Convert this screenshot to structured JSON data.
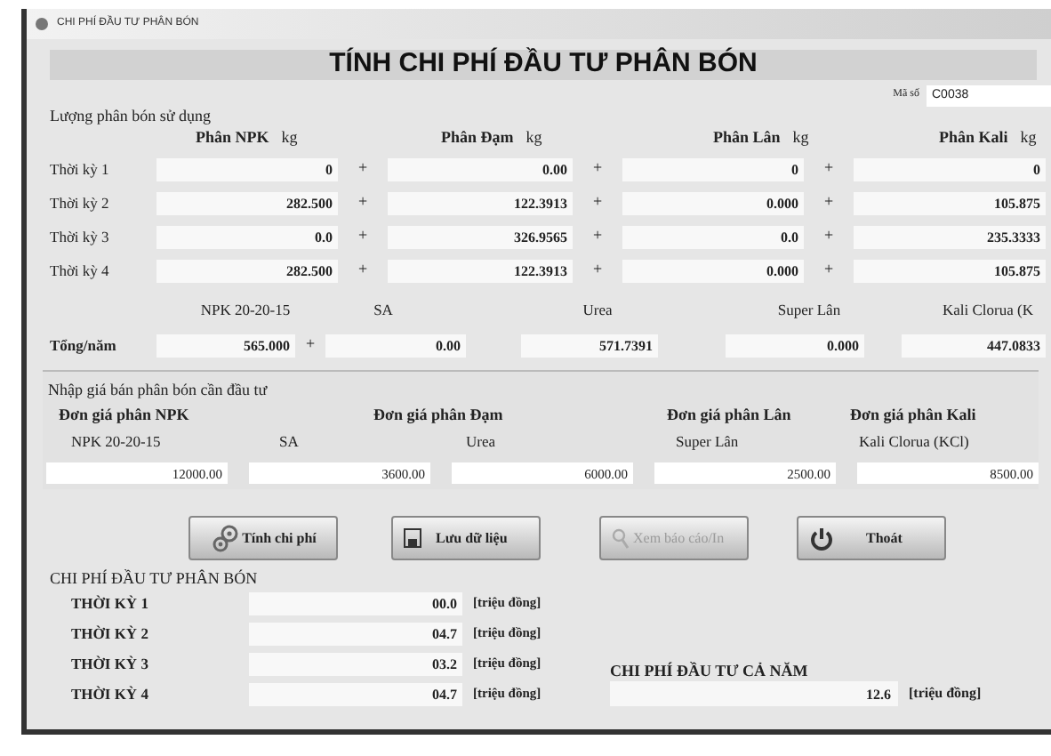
{
  "window": {
    "title": "CHI PHÍ ĐẦU TƯ PHÂN BÓN"
  },
  "header": "TÍNH CHI PHÍ ĐẦU TƯ PHÂN BÓN",
  "code": {
    "label": "Mã số",
    "value": "C0038"
  },
  "usage": {
    "title": "Lượng phân bón sử dụng",
    "columns": [
      {
        "name": "Phân NPK",
        "unit": "kg"
      },
      {
        "name": "Phân Đạm",
        "unit": "kg"
      },
      {
        "name": "Phân Lân",
        "unit": "kg"
      },
      {
        "name": "Phân Kali",
        "unit": "kg"
      }
    ],
    "rows": [
      {
        "label": "Thời kỳ 1",
        "cells": [
          {
            "value": "0",
            "plus": "+"
          },
          {
            "value": "0.00",
            "plus": "+"
          },
          {
            "value": "0",
            "plus": "+"
          },
          {
            "value": "0"
          }
        ]
      },
      {
        "label": "Thời kỳ 2",
        "cells": [
          {
            "value": "282.500",
            "plus": "+"
          },
          {
            "value": "122.3913",
            "plus": "+"
          },
          {
            "value": "0.000",
            "plus": "+"
          },
          {
            "value": "105.875"
          }
        ]
      },
      {
        "label": "Thời kỳ 3",
        "cells": [
          {
            "value": "0.0",
            "plus": "+"
          },
          {
            "value": "326.9565",
            "plus": "+"
          },
          {
            "value": "0.0",
            "plus": "+"
          },
          {
            "value": "235.3333"
          }
        ]
      },
      {
        "label": "Thời kỳ 4",
        "cells": [
          {
            "value": "282.500",
            "plus": "+"
          },
          {
            "value": "122.3913",
            "plus": "+"
          },
          {
            "value": "0.000",
            "plus": "+"
          },
          {
            "value": "105.875"
          }
        ]
      }
    ],
    "products": [
      "NPK 20-20-15",
      "SA",
      "Urea",
      "Super Lân",
      "Kali Clorua (K"
    ],
    "total": {
      "label": "Tổng/năm",
      "cells": [
        {
          "value": "565.000",
          "plus": "+"
        },
        {
          "value": "0.00"
        },
        {
          "value": "571.7391"
        },
        {
          "value": "0.000"
        },
        {
          "value": "447.0833"
        }
      ]
    }
  },
  "prices": {
    "title": "Nhập giá bán phân bón cần đầu tư",
    "headers": [
      "Đơn giá phân NPK",
      "Đơn giá phân Đạm",
      "Đơn giá phân Lân",
      "Đơn giá phân Kali"
    ],
    "products": [
      "NPK 20-20-15",
      "SA",
      "Urea",
      "Super Lân",
      "Kali Clorua (KCl)"
    ],
    "values": [
      "12000.00",
      "3600.00",
      "6000.00",
      "2500.00",
      "8500.00"
    ]
  },
  "buttons": [
    {
      "label": "Tính chi phí",
      "kind": "calculate",
      "disabled": false
    },
    {
      "label": "Lưu dữ liệu",
      "kind": "save",
      "disabled": false
    },
    {
      "label": "Xem báo cáo/In",
      "kind": "report",
      "disabled": true
    },
    {
      "label": "Thoát",
      "kind": "exit",
      "disabled": false
    }
  ],
  "results": {
    "title": "CHI PHÍ ĐẦU TƯ PHÂN BÓN",
    "rows": [
      {
        "label": "THỜI KỲ 1",
        "value": "00.0",
        "unit": "[triệu đồng]"
      },
      {
        "label": "THỜI KỲ 2",
        "value": "04.7",
        "unit": "[triệu đồng]"
      },
      {
        "label": "THỜI KỲ 3",
        "value": "03.2",
        "unit": "[triệu đồng]"
      },
      {
        "label": "THỜI KỲ 4",
        "value": "04.7",
        "unit": "[triệu đồng]"
      }
    ],
    "annual": {
      "label": "CHI PHÍ ĐẦU TƯ CẢ NĂM",
      "value": "12.6",
      "unit": "[triệu đồng]"
    }
  }
}
